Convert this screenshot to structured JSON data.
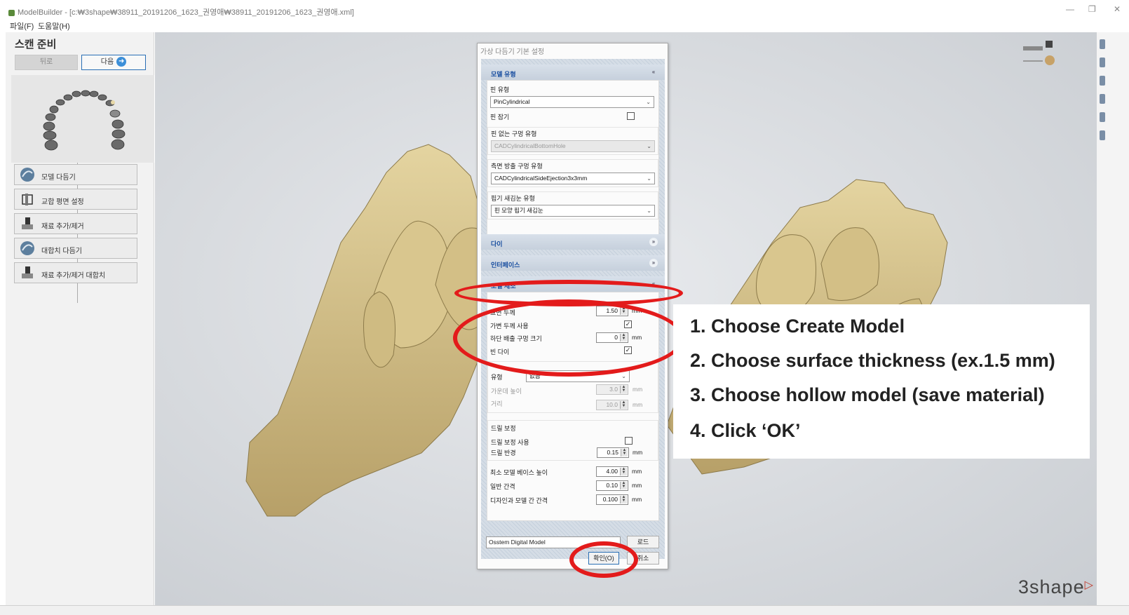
{
  "window": {
    "title": "ModelBuilder - [c:₩3shape₩38911_20191206_1623_권영애₩38911_20191206_1623_권영애.xml]",
    "minimize": "—",
    "restore": "❐",
    "close": "✕"
  },
  "menu": {
    "file": "파일(F)",
    "help": "도움말(H)"
  },
  "left_panel": {
    "title": "스캔 준비",
    "back_label": "뒤로",
    "next_label": "다음",
    "steps": [
      "모델 다듬기",
      "교합 평면 설정",
      "재료 추가/제거",
      "대합치 다듬기",
      "재료 추가/제거 대합치"
    ]
  },
  "dialog": {
    "title": "가상 다듬기 기본 설정",
    "sections": {
      "model_type": "모델 유형",
      "die": "다이",
      "interface": "인터페이스",
      "model_create": "모델 제조",
      "expand_icon": "»",
      "collapse_icon": "«"
    },
    "model_type": {
      "pin_type_label": "핀 유형",
      "pin_type_value": "PinCylindrical",
      "pin_hole_label": "핀 잠기",
      "pinless_hole_label": "핀 없는 구멍 유형",
      "pinless_hole_value": "CADCylindricalBottomHole",
      "side_eject_label": "측면 방출 구멍 유형",
      "side_eject_value": "CADCylindricalSideEjection3x3mm",
      "drill_mark_label": "핍기 새김눈 유형",
      "drill_mark_value": "핀 모양 핍기 새김눈"
    },
    "model_create": {
      "surface_thickness_label": "표면 두께",
      "surface_thickness_value": "1.50",
      "variable_thickness_label": "가변 두께 사용",
      "bottom_vent_label": "하단 배출 구멍 크기",
      "bottom_vent_value": "0",
      "hollow_die_label": "빈 다이",
      "type_label": "유형",
      "type_value": "없음",
      "center_height_label": "가운데 높이",
      "center_height_value": "3.0",
      "distance_label": "거리",
      "distance_value": "10.0",
      "drill_group_label": "드릴 보정",
      "drill_use_label": "드릴 보정 사용",
      "drill_radius_label": "드릴 반경",
      "drill_radius_value": "0.15",
      "min_base_label": "최소 모델 베이스 높이",
      "min_base_value": "4.00",
      "general_gap_label": "일반 간격",
      "general_gap_value": "0.10",
      "design_gap_label": "디자인과 모델 간 간격",
      "design_gap_value": "0.100",
      "unit": "mm"
    },
    "profile_value": "Osstem Digital Model",
    "load_label": "로드",
    "ok_label": "확인(O)",
    "cancel_label": "취소"
  },
  "checkboxes": {
    "pin_hole": false,
    "variable_thickness": true,
    "hollow_die": true,
    "drill_use": false
  },
  "callout": {
    "line1": "1. Choose Create Model",
    "line2": "2. Choose surface thickness (ex.1.5 mm)",
    "line3": "3. Choose hollow model (save material)",
    "line4": "4. Click ‘OK’"
  },
  "brand": "3shape",
  "colors": {
    "highlight_red": "#e31b1b",
    "section_text": "#1a4fa0",
    "model": "#c9b47e"
  }
}
